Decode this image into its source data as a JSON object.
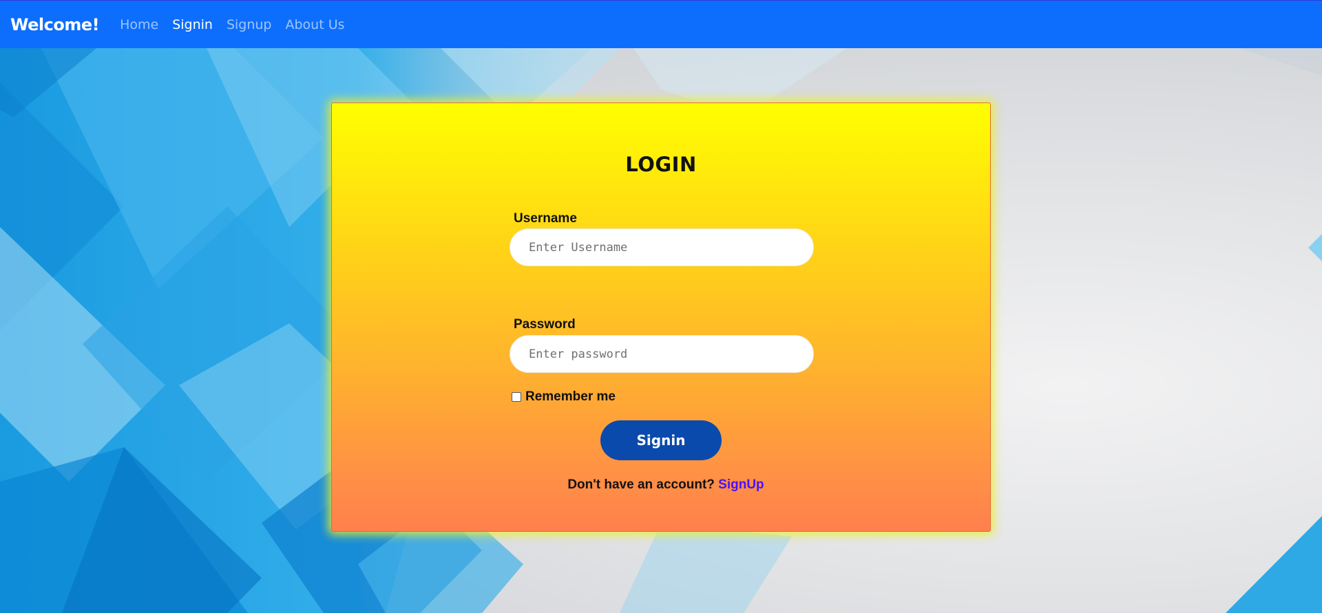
{
  "navbar": {
    "brand": "Welcome!",
    "links": [
      {
        "label": "Home",
        "active": false
      },
      {
        "label": "Signin",
        "active": true
      },
      {
        "label": "Signup",
        "active": false
      },
      {
        "label": "About Us",
        "active": false
      }
    ],
    "background_color": "#0d6efd"
  },
  "login": {
    "title": "LOGIN",
    "username_label": "Username",
    "username_placeholder": "Enter Username",
    "username_value": "",
    "password_label": "Password",
    "password_placeholder": "Enter password",
    "password_value": "",
    "remember_label": "Remember me",
    "remember_checked": false,
    "signin_button": "Signin",
    "signup_prompt": "Don't have an account?",
    "signup_link": "SignUp",
    "button_color": "#0a4aac",
    "link_color": "#4a10ff"
  }
}
